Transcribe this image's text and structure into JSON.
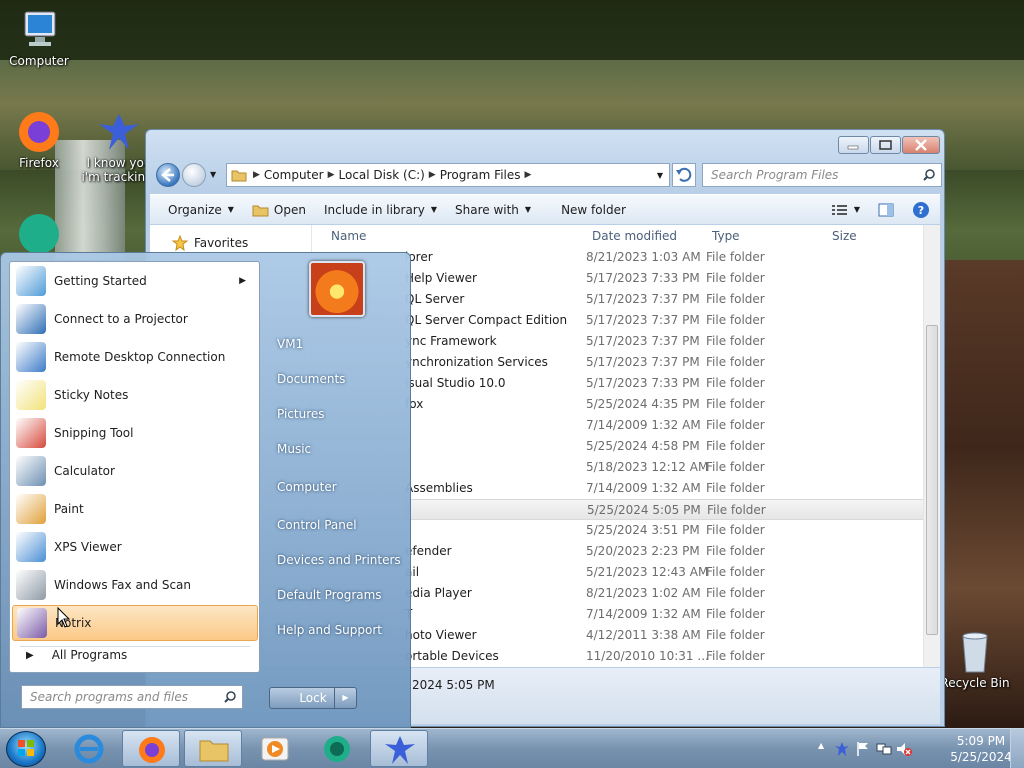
{
  "desktop": {
    "icons": [
      {
        "label": "Computer",
        "icon": "computer-icon"
      },
      {
        "label": "Firefox",
        "icon": "firefox-icon"
      },
      {
        "label": "I know you i'm trackin...",
        "icon": "bird-icon"
      },
      {
        "label": "Recycle Bin",
        "icon": "recycle-bin-icon"
      }
    ]
  },
  "explorer": {
    "breadcrumbs": [
      "Computer",
      "Local Disk (C:)",
      "Program Files"
    ],
    "search_placeholder": "Search Program Files",
    "toolbar": {
      "organize": "Organize",
      "open": "Open",
      "include": "Include in library",
      "share": "Share with",
      "new_folder": "New folder"
    },
    "nav": {
      "favorites": "Favorites"
    },
    "columns": {
      "name": "Name",
      "date": "Date modified",
      "type": "Type",
      "size": "Size"
    },
    "rows": [
      {
        "name": "lorer",
        "date": "8/21/2023 1:03 AM",
        "type": "File folder"
      },
      {
        "name": "Help Viewer",
        "date": "5/17/2023 7:33 PM",
        "type": "File folder"
      },
      {
        "name": "QL Server",
        "date": "5/17/2023 7:37 PM",
        "type": "File folder"
      },
      {
        "name": "QL Server Compact Edition",
        "date": "5/17/2023 7:37 PM",
        "type": "File folder"
      },
      {
        "name": "ync Framework",
        "date": "5/17/2023 7:37 PM",
        "type": "File folder"
      },
      {
        "name": "ynchronization Services",
        "date": "5/17/2023 7:37 PM",
        "type": "File folder"
      },
      {
        "name": "isual Studio 10.0",
        "date": "5/17/2023 7:33 PM",
        "type": "File folder"
      },
      {
        "name": "fox",
        "date": "5/25/2024 4:35 PM",
        "type": "File folder"
      },
      {
        "name": "",
        "date": "7/14/2009 1:32 AM",
        "type": "File folder"
      },
      {
        "name": "",
        "date": "5/25/2024 4:58 PM",
        "type": "File folder"
      },
      {
        "name": "",
        "date": "5/18/2023 12:12 AM",
        "type": "File folder"
      },
      {
        "name": "Assemblies",
        "date": "7/14/2009 1:32 AM",
        "type": "File folder"
      },
      {
        "name": "",
        "date": "5/25/2024 5:05 PM",
        "type": "File folder"
      },
      {
        "name": "",
        "date": "5/25/2024 3:51 PM",
        "type": "File folder"
      },
      {
        "name": "efender",
        "date": "5/20/2023 2:23 PM",
        "type": "File folder"
      },
      {
        "name": "ail",
        "date": "5/21/2023 12:43 AM",
        "type": "File folder"
      },
      {
        "name": "edia Player",
        "date": "8/21/2023 1:02 AM",
        "type": "File folder"
      },
      {
        "name": "T",
        "date": "7/14/2009 1:32 AM",
        "type": "File folder"
      },
      {
        "name": "hoto Viewer",
        "date": "4/12/2011 3:38 AM",
        "type": "File folder"
      },
      {
        "name": "ortable Devices",
        "date": "11/20/2010 10:31 ...",
        "type": "File folder"
      }
    ],
    "status": "2024 5:05 PM"
  },
  "startmenu": {
    "programs": [
      {
        "label": "Getting Started",
        "icon": "getting-started-icon",
        "color": "#4f9bd8"
      },
      {
        "label": "Connect to a Projector",
        "icon": "projector-icon",
        "color": "#2f6fb5"
      },
      {
        "label": "Remote Desktop Connection",
        "icon": "remote-desktop-icon",
        "color": "#3d7cc7"
      },
      {
        "label": "Sticky Notes",
        "icon": "sticky-notes-icon",
        "color": "#f2e27a"
      },
      {
        "label": "Snipping Tool",
        "icon": "scissors-icon",
        "color": "#d64a3c"
      },
      {
        "label": "Calculator",
        "icon": "calculator-icon",
        "color": "#6d8fb2"
      },
      {
        "label": "Paint",
        "icon": "paint-icon",
        "color": "#e0a13a"
      },
      {
        "label": "XPS Viewer",
        "icon": "xps-viewer-icon",
        "color": "#4a8fd4"
      },
      {
        "label": "Windows Fax and Scan",
        "icon": "fax-icon",
        "color": "#8f9aa6"
      },
      {
        "label": "Notrix",
        "icon": "notrix-icon",
        "color": "#7a5aa8"
      }
    ],
    "all_programs": "All Programs",
    "search_placeholder": "Search programs and files",
    "places": [
      "VM1",
      "Documents",
      "Pictures",
      "Music",
      "Computer",
      "Control Panel",
      "Devices and Printers",
      "Default Programs",
      "Help and Support"
    ],
    "lock": "Lock"
  },
  "taskbar": {
    "clock_time": "5:09 PM",
    "clock_date": "5/25/2024"
  }
}
